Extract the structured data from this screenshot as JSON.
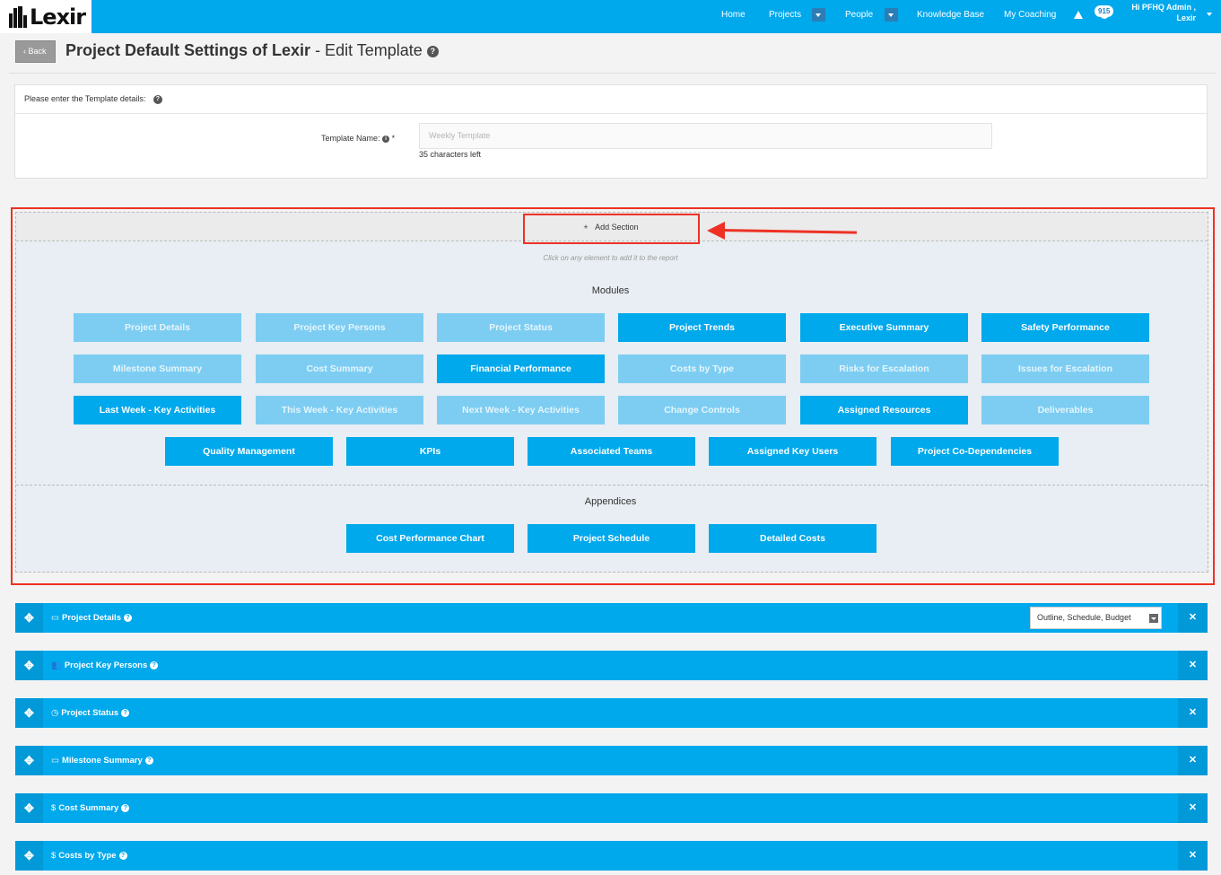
{
  "app": {
    "logo_text": "Lexir"
  },
  "nav": {
    "home": "Home",
    "projects": "Projects",
    "people": "People",
    "knowledge_base": "Knowledge Base",
    "my_coaching": "My Coaching",
    "notification_count": "915",
    "user_line1": "Hi PFHQ Admin ,",
    "user_line2": "Lexir"
  },
  "header": {
    "back_label": "Back",
    "title_bold": "Project Default Settings of Lexir",
    "title_rest": " - Edit Template"
  },
  "details": {
    "prompt": "Please enter the Template details:",
    "template_name_label": "Template Name:",
    "required_mark": "*",
    "template_name_placeholder": "Weekly Template",
    "chars_left": "35 characters left"
  },
  "builder": {
    "add_section_label": "Add Section",
    "hint": "Click on any element to add it to the report",
    "modules_title": "Modules",
    "appendices_title": "Appendices",
    "modules": [
      {
        "label": "Project Details",
        "active": false
      },
      {
        "label": "Project Key Persons",
        "active": false
      },
      {
        "label": "Project Status",
        "active": false
      },
      {
        "label": "Project Trends",
        "active": true
      },
      {
        "label": "Executive Summary",
        "active": true
      },
      {
        "label": "Safety Performance",
        "active": true
      },
      {
        "label": "Milestone Summary",
        "active": false
      },
      {
        "label": "Cost Summary",
        "active": false
      },
      {
        "label": "Financial Performance",
        "active": true
      },
      {
        "label": "Costs by Type",
        "active": false
      },
      {
        "label": "Risks for Escalation",
        "active": false
      },
      {
        "label": "Issues for Escalation",
        "active": false
      },
      {
        "label": "Last Week - Key Activities",
        "active": true
      },
      {
        "label": "This Week - Key Activities",
        "active": false
      },
      {
        "label": "Next Week - Key Activities",
        "active": false
      },
      {
        "label": "Change Controls",
        "active": false
      },
      {
        "label": "Assigned Resources",
        "active": true
      },
      {
        "label": "Deliverables",
        "active": false
      },
      {
        "label": "Quality Management",
        "active": true
      },
      {
        "label": "KPIs",
        "active": true
      },
      {
        "label": "Associated Teams",
        "active": true
      },
      {
        "label": "Assigned Key Users",
        "active": true
      },
      {
        "label": "Project Co-Dependencies",
        "active": true
      }
    ],
    "appendices": [
      {
        "label": "Cost Performance Chart",
        "active": true
      },
      {
        "label": "Project Schedule",
        "active": true
      },
      {
        "label": "Detailed Costs",
        "active": true
      }
    ]
  },
  "sections": [
    {
      "label": "Project Details",
      "icon": "calendar-icon",
      "glyph": "▭",
      "select_value": "Outline, Schedule, Budget"
    },
    {
      "label": "Project Key Persons",
      "icon": "users-icon",
      "glyph": "👥"
    },
    {
      "label": "Project Status",
      "icon": "clock-icon",
      "glyph": "◷"
    },
    {
      "label": "Milestone Summary",
      "icon": "calendar-icon",
      "glyph": "▭"
    },
    {
      "label": "Cost Summary",
      "icon": "dollar-icon",
      "glyph": "$"
    },
    {
      "label": "Costs by Type",
      "icon": "dollar-icon",
      "glyph": "$"
    }
  ],
  "colors": {
    "brand": "#00a8ec",
    "inactive_module": "#7dcdf2",
    "highlight": "#ee3124"
  }
}
